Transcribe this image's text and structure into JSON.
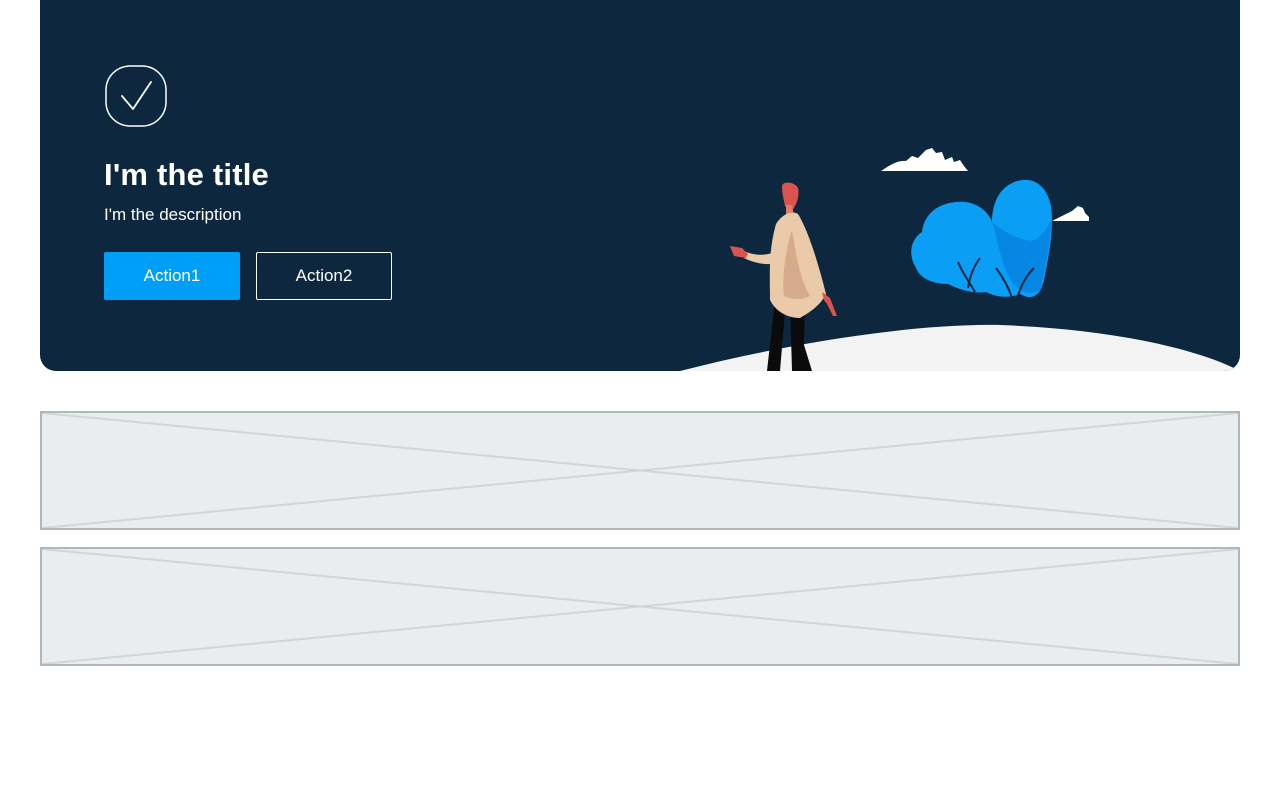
{
  "hero": {
    "icon": "check-circle-icon",
    "title": "I'm the title",
    "description": "I'm the description",
    "actions": {
      "primary_label": "Action1",
      "secondary_label": "Action2"
    },
    "illustration": "person-walking-illustration"
  },
  "placeholders": [
    {
      "icon": "image-placeholder-icon"
    },
    {
      "icon": "image-placeholder-icon"
    }
  ],
  "colors": {
    "hero_background": "#0d283e",
    "primary": "#009ff7",
    "placeholder_fill": "#e9edee",
    "placeholder_border": "#aeb7bc"
  }
}
